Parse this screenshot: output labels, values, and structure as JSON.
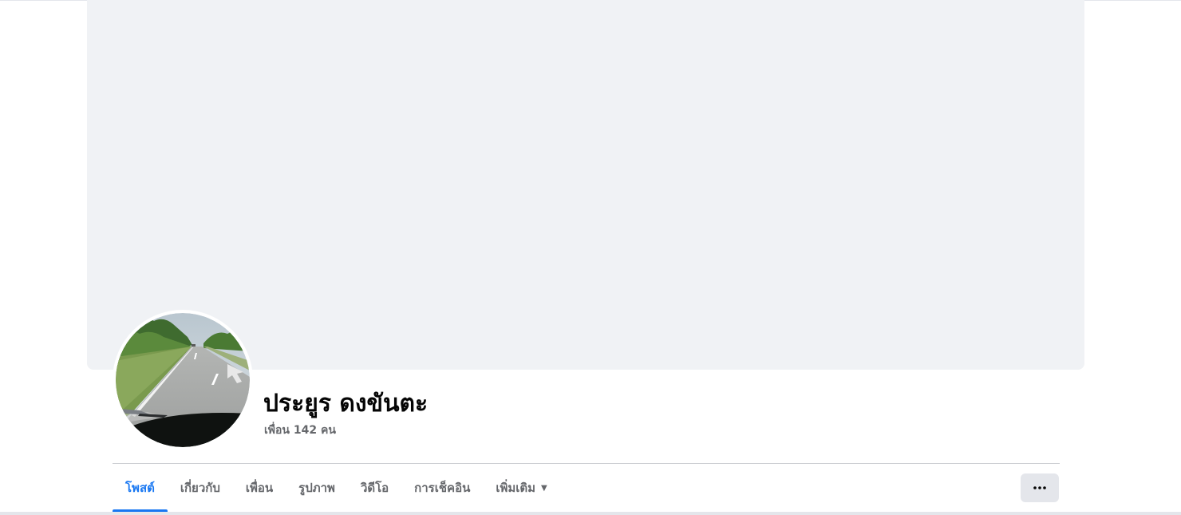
{
  "profile": {
    "name": "ประยูร ดงขันตะ",
    "friends_text": "เพื่อน 142 คน"
  },
  "tabs": [
    {
      "label": "โพสต์",
      "active": true
    },
    {
      "label": "เกี่ยวกับ",
      "active": false
    },
    {
      "label": "เพื่อน",
      "active": false
    },
    {
      "label": "รูปภาพ",
      "active": false
    },
    {
      "label": "วิดีโอ",
      "active": false
    },
    {
      "label": "การเช็คอิน",
      "active": false
    },
    {
      "label": "เพิ่มเติม",
      "active": false,
      "dropdown": true
    }
  ],
  "icons": {
    "more_dropdown": "caret-down-icon",
    "options_button": "ellipsis-icon"
  },
  "colors": {
    "accent": "#1877f2",
    "cover_bg": "#f0f2f5",
    "secondary_text": "#65676b",
    "primary_text": "#050505",
    "button_bg": "#e4e6eb"
  }
}
